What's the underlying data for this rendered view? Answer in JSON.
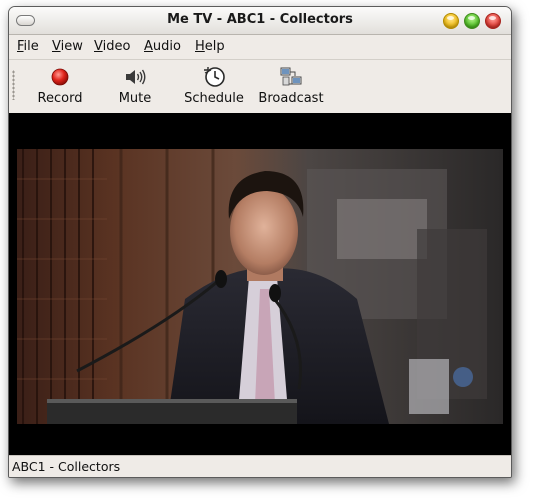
{
  "window": {
    "title": "Me TV - ABC1 - Collectors"
  },
  "menubar": {
    "items": [
      {
        "mnemonic": "F",
        "rest": "ile"
      },
      {
        "mnemonic": "V",
        "rest": "iew"
      },
      {
        "mnemonic": "V",
        "rest": "ideo"
      },
      {
        "mnemonic": "A",
        "rest": "udio"
      },
      {
        "mnemonic": "H",
        "rest": "elp"
      }
    ]
  },
  "toolbar": {
    "record_label": "Record",
    "mute_label": "Mute",
    "schedule_label": "Schedule",
    "broadcast_label": "Broadcast"
  },
  "icons": {
    "record": "record-icon",
    "mute": "speaker-icon",
    "schedule": "clock-icon",
    "broadcast": "broadcast-icon"
  },
  "colors": {
    "record_red": "#e0241b",
    "minimize_yellow": "#f2c01b",
    "maximize_green": "#56c42b",
    "close_red": "#e4423a",
    "video_background": "#000000"
  },
  "status": {
    "text": "ABC1 - Collectors"
  }
}
